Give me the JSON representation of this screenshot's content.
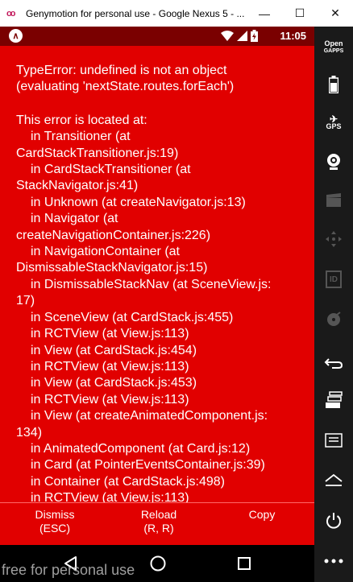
{
  "window": {
    "title": "Genymotion for personal use - Google Nexus 5 - ...",
    "logo_glyph": "oo",
    "minimize_glyph": "—",
    "maximize_glyph": "☐",
    "close_glyph": "✕"
  },
  "statusbar": {
    "app_glyph": "∧",
    "time": "11:05"
  },
  "error": {
    "title_lines": [
      "TypeError: undefined is not an object",
      "(evaluating 'nextState.routes.forEach')"
    ],
    "location_header": "This error is located at:",
    "stack": [
      {
        "text": "in Transitioner (at",
        "indent": true
      },
      {
        "text": "CardStackTransitioner.js:19)",
        "indent": false
      },
      {
        "text": "in CardStackTransitioner (at",
        "indent": true
      },
      {
        "text": "StackNavigator.js:41)",
        "indent": false
      },
      {
        "text": "in Unknown (at createNavigator.js:13)",
        "indent": true
      },
      {
        "text": "in Navigator (at",
        "indent": true
      },
      {
        "text": "createNavigationContainer.js:226)",
        "indent": false
      },
      {
        "text": "in NavigationContainer (at",
        "indent": true
      },
      {
        "text": "DismissableStackNavigator.js:15)",
        "indent": false
      },
      {
        "text": "in DismissableStackNav (at SceneView.js:",
        "indent": true
      },
      {
        "text": "17)",
        "indent": false
      },
      {
        "text": "in SceneView (at CardStack.js:455)",
        "indent": true
      },
      {
        "text": "in RCTView (at View.js:113)",
        "indent": true
      },
      {
        "text": "in View (at CardStack.js:454)",
        "indent": true
      },
      {
        "text": "in RCTView (at View.js:113)",
        "indent": true
      },
      {
        "text": "in View (at CardStack.js:453)",
        "indent": true
      },
      {
        "text": "in RCTView (at View.js:113)",
        "indent": true
      },
      {
        "text": "in View (at createAnimatedComponent.js:",
        "indent": true
      },
      {
        "text": "134)",
        "indent": false
      },
      {
        "text": "in AnimatedComponent (at Card.js:12)",
        "indent": true
      },
      {
        "text": "in Card (at PointerEventsContainer.js:39)",
        "indent": true
      },
      {
        "text": "in Container (at CardStack.js:498)",
        "indent": true
      },
      {
        "text": "in RCTView (at View.js:113)",
        "indent": true
      }
    ]
  },
  "footer": {
    "dismiss": {
      "label": "Dismiss",
      "shortcut": "(ESC)"
    },
    "reload": {
      "label": "Reload",
      "shortcut": "(R, R)"
    },
    "copy": {
      "label": "Copy"
    }
  },
  "watermark": "free for personal use",
  "sidebar": {
    "opengapps_line1": "Open",
    "opengapps_line2": "GAPPS",
    "gps_label": "GPS",
    "id_label": "ID"
  },
  "colors": {
    "redbox": "#e10000",
    "statusbar": "#7a0000",
    "sidebar": "#1a1a1a"
  }
}
